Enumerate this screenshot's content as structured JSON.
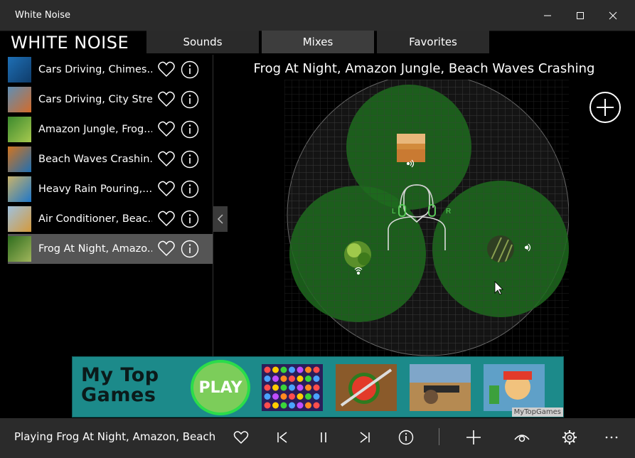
{
  "window": {
    "title": "White Noise",
    "minimize_icon": "minimize-icon",
    "maximize_icon": "maximize-icon",
    "close_icon": "close-icon"
  },
  "app": {
    "title": "WHITE NOISE"
  },
  "tabs": [
    {
      "label": "Sounds",
      "active": false
    },
    {
      "label": "Mixes",
      "active": true
    },
    {
      "label": "Favorites",
      "active": false
    }
  ],
  "sidebar": {
    "items": [
      {
        "label": "Cars Driving, Chimes...",
        "selected": false,
        "thumb_colors": [
          "#1e6fb5",
          "#0f3c6a"
        ]
      },
      {
        "label": "Cars Driving, City Stre...",
        "selected": false,
        "thumb_colors": [
          "#5f8fb5",
          "#d46b2a"
        ]
      },
      {
        "label": "Amazon Jungle, Frog...",
        "selected": false,
        "thumb_colors": [
          "#3c8a2e",
          "#a7c94f"
        ]
      },
      {
        "label": "Beach Waves Crashin...",
        "selected": false,
        "thumb_colors": [
          "#d2741f",
          "#1f6fb3"
        ]
      },
      {
        "label": "Heavy Rain Pouring,...",
        "selected": false,
        "thumb_colors": [
          "#c8b26a",
          "#1f77c9"
        ]
      },
      {
        "label": "Air Conditioner, Beac...",
        "selected": false,
        "thumb_colors": [
          "#9fc1de",
          "#d59a3c"
        ]
      },
      {
        "label": "Frog At Night, Amazo...",
        "selected": true,
        "thumb_colors": [
          "#2f6d1e",
          "#a0b55b"
        ]
      }
    ],
    "favorite_icon": "heart-icon",
    "info_icon": "info-icon",
    "collapse_icon": "chevron-left-icon"
  },
  "mix": {
    "title": "Frog At Night, Amazon Jungle, Beach Waves Crashing",
    "add_icon": "plus-circle-icon",
    "listener_labels": {
      "left": "L",
      "right": "R"
    },
    "accent_green": "#2e8b2e"
  },
  "ad": {
    "text": "My Top Games",
    "play_label": "PLAY",
    "brand": "MyTopGames"
  },
  "bottom_bar": {
    "now_playing": "Playing Frog At Night, Amazon, Beach",
    "buttons": [
      "heart-icon",
      "previous-icon",
      "pause-icon",
      "next-icon",
      "info-icon",
      "plus-icon",
      "eye-icon",
      "gear-icon",
      "more-icon"
    ]
  }
}
